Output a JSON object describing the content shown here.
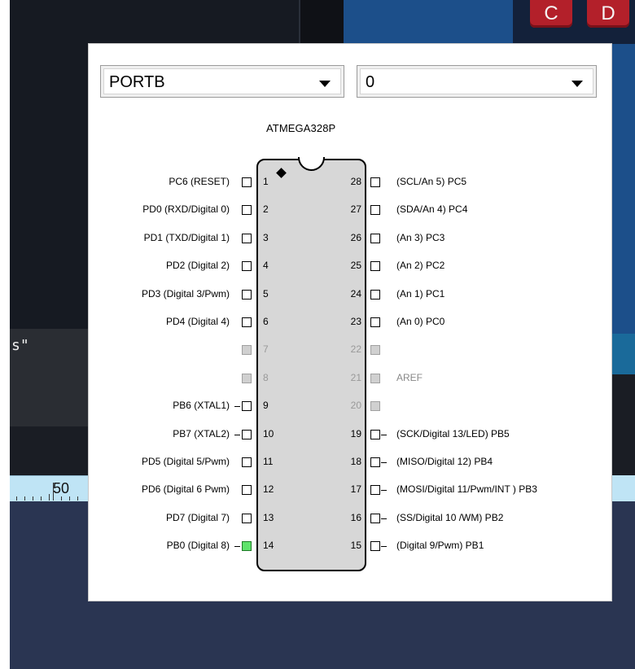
{
  "background": {
    "key_buttons": [
      "C",
      "D"
    ],
    "left_text": "s\"",
    "ruler_label": "50"
  },
  "dialog": {
    "port_select": {
      "value": "PORTB"
    },
    "bit_select": {
      "value": "0"
    },
    "chip_name": "ATMEGA328P",
    "active_pin_color": "#5fe36b",
    "left_pins": [
      {
        "num": "1",
        "label": "PC6 (RESET)",
        "state": "normal",
        "dash": false
      },
      {
        "num": "2",
        "label": "PD0 (RXD/Digital 0)",
        "state": "normal",
        "dash": false
      },
      {
        "num": "3",
        "label": "PD1 (TXD/Digital 1)",
        "state": "normal",
        "dash": false
      },
      {
        "num": "4",
        "label": "PD2 (Digital 2)",
        "state": "normal",
        "dash": false
      },
      {
        "num": "5",
        "label": "PD3 (Digital 3/Pwm)",
        "state": "normal",
        "dash": false
      },
      {
        "num": "6",
        "label": "PD4 (Digital 4)",
        "state": "normal",
        "dash": false
      },
      {
        "num": "7",
        "label": "",
        "state": "grey",
        "dash": false
      },
      {
        "num": "8",
        "label": "",
        "state": "grey",
        "dash": false
      },
      {
        "num": "9",
        "label": "PB6 (XTAL1)",
        "state": "normal",
        "dash": true
      },
      {
        "num": "10",
        "label": "PB7 (XTAL2)",
        "state": "normal",
        "dash": true
      },
      {
        "num": "11",
        "label": "PD5 (Digital 5/Pwm)",
        "state": "normal",
        "dash": false
      },
      {
        "num": "12",
        "label": "PD6 (Digital 6 Pwm)",
        "state": "normal",
        "dash": false
      },
      {
        "num": "13",
        "label": "PD7 (Digital 7)",
        "state": "normal",
        "dash": false
      },
      {
        "num": "14",
        "label": "PB0 (Digital 8)",
        "state": "active",
        "dash": true
      }
    ],
    "right_pins": [
      {
        "num": "28",
        "label": "(SCL/An 5) PC5",
        "state": "normal",
        "dash": false
      },
      {
        "num": "27",
        "label": "(SDA/An 4) PC4",
        "state": "normal",
        "dash": false
      },
      {
        "num": "26",
        "label": "(An 3) PC3",
        "state": "normal",
        "dash": false
      },
      {
        "num": "25",
        "label": "(An 2) PC2",
        "state": "normal",
        "dash": false
      },
      {
        "num": "24",
        "label": "(An 1) PC1",
        "state": "normal",
        "dash": false
      },
      {
        "num": "23",
        "label": "(An 0) PC0",
        "state": "normal",
        "dash": false
      },
      {
        "num": "22",
        "label": "",
        "state": "grey",
        "dash": false
      },
      {
        "num": "21",
        "label": "AREF",
        "state": "grey",
        "dash": false
      },
      {
        "num": "20",
        "label": "",
        "state": "grey",
        "dash": false
      },
      {
        "num": "19",
        "label": "(SCK/Digital 13/LED) PB5",
        "state": "normal",
        "dash": true
      },
      {
        "num": "18",
        "label": "(MISO/Digital 12)  PB4",
        "state": "normal",
        "dash": true
      },
      {
        "num": "17",
        "label": "(MOSI/Digital 11/Pwm/INT ) PB3",
        "state": "normal",
        "dash": true
      },
      {
        "num": "16",
        "label": "(SS/Digital 10 /WM) PB2",
        "state": "normal",
        "dash": true
      },
      {
        "num": "15",
        "label": "(Digital 9/Pwm) PB1",
        "state": "normal",
        "dash": true
      }
    ]
  }
}
